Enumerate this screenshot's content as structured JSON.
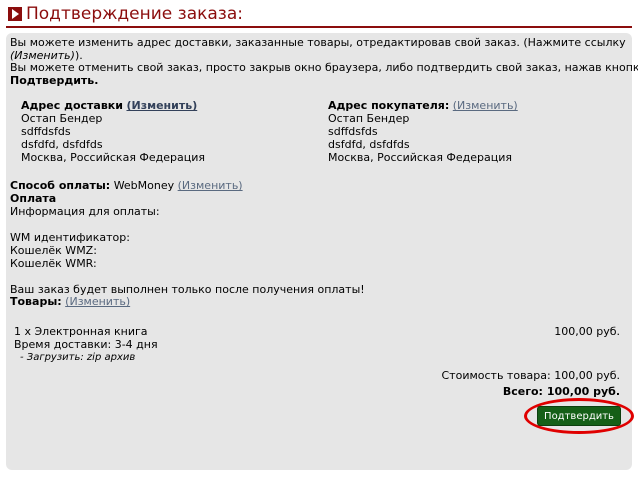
{
  "header": {
    "title": "Подтверждение заказа:"
  },
  "intro": {
    "line1": "Вы можете изменить адрес доставки, заказанные товары, отредактировав свой заказ. (Нажмите ссылку",
    "line2_link": "(Изменить)",
    "line2_suffix": ").",
    "line3": "Вы можете отменить свой заказ, просто закрыв окно браузера, либо подтвердить свой заказ, нажав кнопку",
    "line4": "Подтвердить."
  },
  "shipping": {
    "label": "Адрес доставки",
    "edit_link": "(Изменить)",
    "lines": [
      "Остап Бендер",
      "sdffdsfds",
      "dsfdfd, dsfdfds",
      "Москва, Российская Федерация"
    ]
  },
  "billing": {
    "label": "Адрес покупателя:",
    "edit_link": "(Изменить)",
    "lines": [
      "Остап Бендер",
      "sdffdsfds",
      "dsfdfd, dsfdfds",
      "Москва, Российская Федерация"
    ]
  },
  "payment": {
    "method_label": "Способ оплаты:",
    "method_value": "WebMoney",
    "edit_link": "(Изменить)",
    "section_title": "Оплата",
    "info_label": "Информация для оплаты:",
    "wm_id_label": "WM идентификатор:",
    "wmz_label": "Кошелёк WMZ:",
    "wmr_label": "Кошелёк WMR:",
    "note": "Ваш заказ будет выполнен только после получения оплаты!"
  },
  "products": {
    "label": "Товары:",
    "edit_link": "(Изменить)",
    "item_name": "1 x Электронная книга",
    "item_price": "100,00 руб.",
    "delivery_time": "Время доставки: 3-4 дня",
    "download": "- Загрузить: zip архив"
  },
  "totals": {
    "subtotal_label": "Стоимость товара:",
    "subtotal_value": "100,00 руб.",
    "total_label": "Всего:",
    "total_value": "100,00 руб."
  },
  "actions": {
    "confirm_label": "Подтвердить"
  },
  "colors": {
    "accent": "#8b0d0d",
    "panel": "#e6e6e6",
    "button": "#155f17",
    "highlight": "#e00000"
  }
}
